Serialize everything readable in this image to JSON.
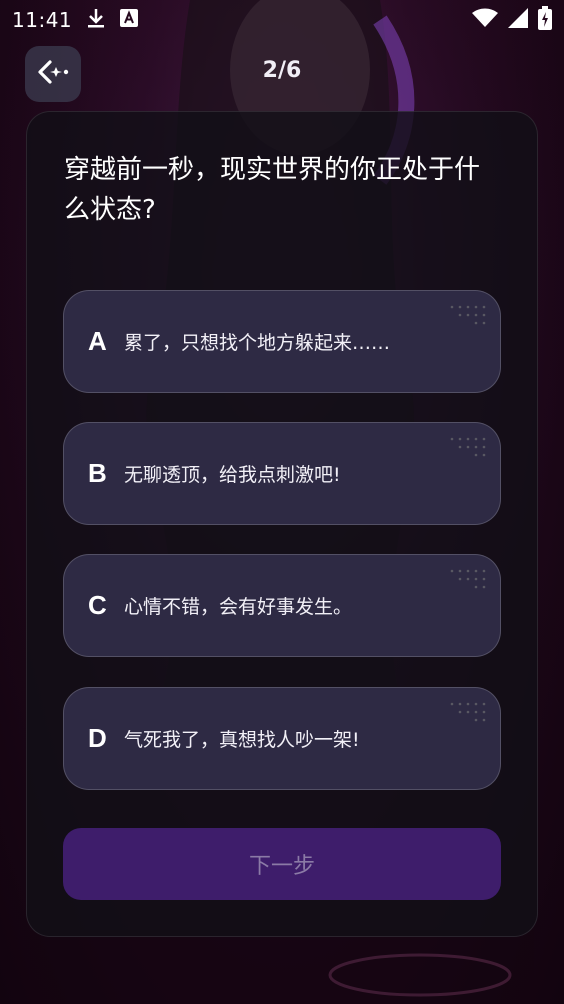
{
  "status_bar": {
    "time": "11:41",
    "icons": [
      "download-icon",
      "keyboard-a-icon",
      "wifi-icon",
      "cell-signal-icon",
      "battery-charging-icon"
    ]
  },
  "header": {
    "back_icon": "sparkle-arrow-back-icon",
    "progress": "2/6"
  },
  "quiz": {
    "question": "穿越前一秒，现实世界的你正处于什么状态?",
    "options": [
      {
        "letter": "A",
        "text": "累了，只想找个地方躲起来……"
      },
      {
        "letter": "B",
        "text": "无聊透顶，给我点刺激吧!"
      },
      {
        "letter": "C",
        "text": "心情不错，会有好事发生。"
      },
      {
        "letter": "D",
        "text": "气死我了，真想找人吵一架!"
      }
    ],
    "next_label": "下一步"
  },
  "colors": {
    "option_bg": "#2e2a44",
    "next_button_bg": "#3e1d6b",
    "next_button_text": "#8b7aa6",
    "background": "#26091f"
  }
}
